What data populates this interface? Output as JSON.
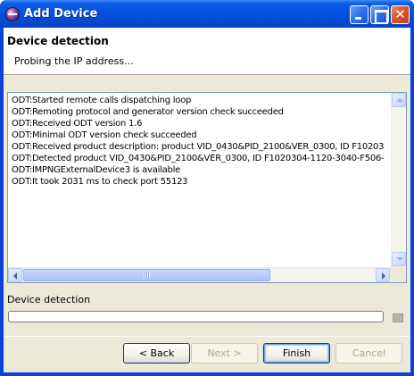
{
  "window": {
    "title": "Add Device",
    "app_icon": "eclipse-icon"
  },
  "header": {
    "title": "Device detection",
    "message": "Probing the IP address..."
  },
  "log": {
    "lines": [
      "ODT:Started remote calls dispatching loop",
      "ODT:Remoting protocol and generator version check succeeded",
      "ODT:Received ODT version 1.6",
      "ODT:Minimal ODT version check succeeded",
      "ODT:Received product description: product VID_0430&PID_2100&VER_0300, ID F10203",
      "ODT:Detected product VID_0430&PID_2100&VER_0300, ID F1020304-1120-3040-F506-",
      "ODT:IMPNGExternalDevice3 is available",
      "ODT:It took 2031 ms to check port 55123"
    ]
  },
  "progress": {
    "label": "Device detection",
    "value": 0.0
  },
  "buttons": {
    "back": "< Back",
    "next": "Next >",
    "finish": "Finish",
    "cancel": "Cancel"
  },
  "colors": {
    "titlebar": "#0652de",
    "dialog_bg": "#ece9d8",
    "progress_fill": "#2ea822",
    "close_button": "#d8532b"
  }
}
